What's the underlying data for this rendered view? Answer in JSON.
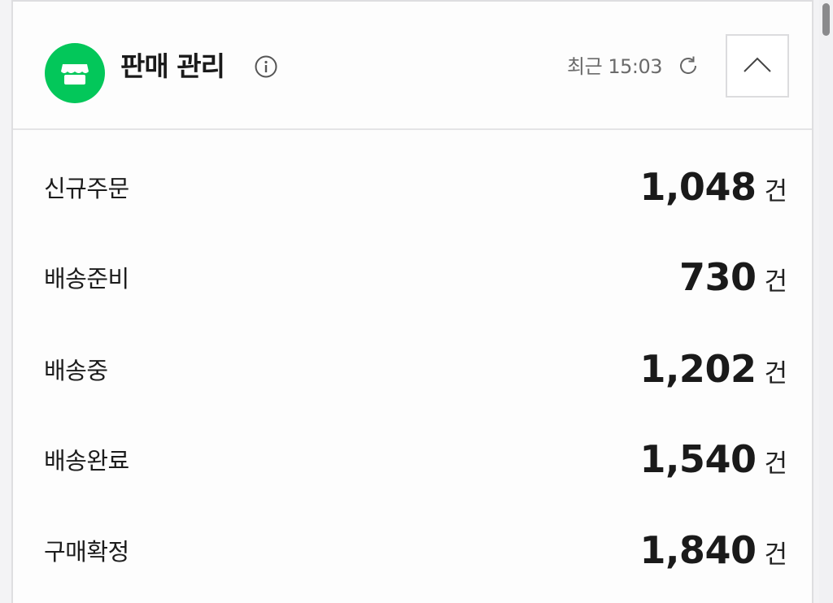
{
  "widget": {
    "title": "판매 관리",
    "updated_label": "최근 15:03",
    "icons": {
      "store": "store-icon",
      "info": "info-icon",
      "refresh": "refresh-icon",
      "collapse": "chevron-up-icon"
    },
    "accent_color": "#03c75a"
  },
  "stats": [
    {
      "label": "신규주문",
      "value": "1,048",
      "unit": "건"
    },
    {
      "label": "배송준비",
      "value": "730",
      "unit": "건"
    },
    {
      "label": "배송중",
      "value": "1,202",
      "unit": "건"
    },
    {
      "label": "배송완료",
      "value": "1,540",
      "unit": "건"
    },
    {
      "label": "구매확정",
      "value": "1,840",
      "unit": "건"
    }
  ]
}
